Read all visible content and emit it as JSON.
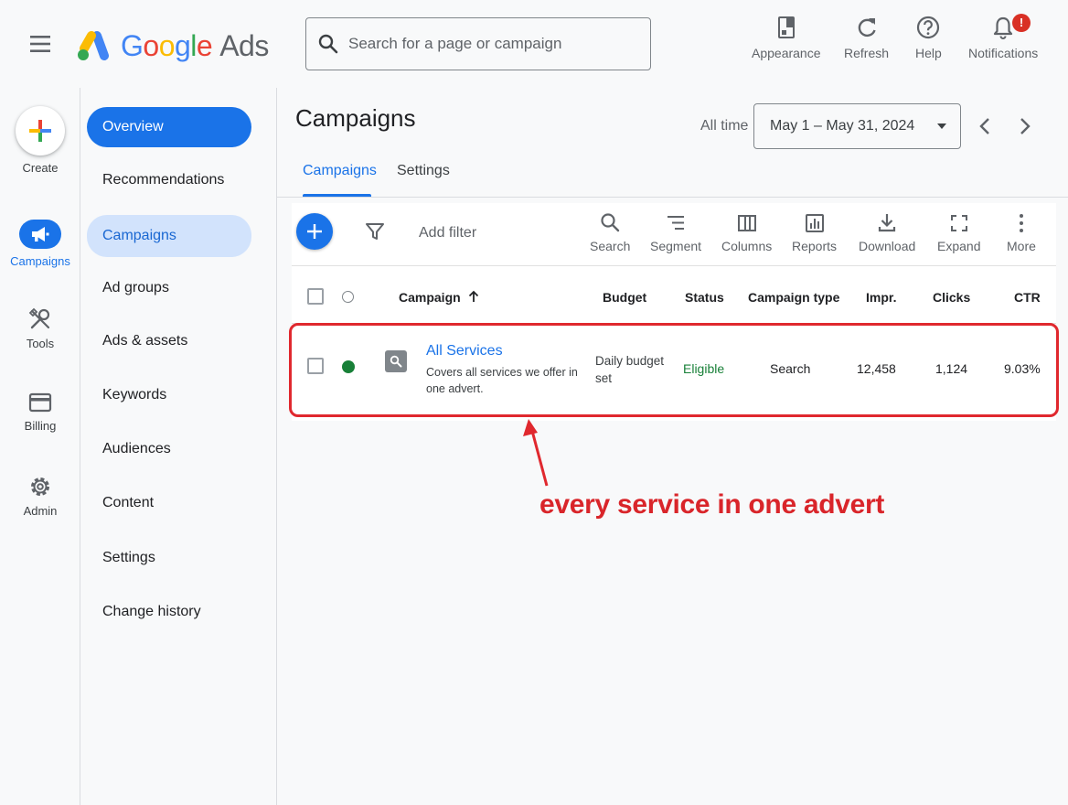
{
  "brand": {
    "google": "Google",
    "ads": "Ads"
  },
  "search": {
    "placeholder": "Search for a page or campaign"
  },
  "top_actions": {
    "appearance": "Appearance",
    "refresh": "Refresh",
    "help": "Help",
    "notifications": "Notifications",
    "notifications_badge": "!"
  },
  "rail": {
    "create": "Create",
    "campaigns": "Campaigns",
    "tools": "Tools",
    "billing": "Billing",
    "admin": "Admin"
  },
  "nav": {
    "items": [
      "Overview",
      "Recommendations",
      "Campaigns",
      "Ad groups",
      "Ads & assets",
      "Keywords",
      "Audiences",
      "Content",
      "Settings",
      "Change history"
    ],
    "selected": "Campaigns"
  },
  "page": {
    "title": "Campaigns",
    "date_label": "All time",
    "date_range": "May 1 – May 31, 2024",
    "tabs": [
      "Campaigns",
      "Settings"
    ],
    "active_tab": "Campaigns"
  },
  "toolbar": {
    "add_filter": "Add filter",
    "tools": [
      "Search",
      "Segment",
      "Columns",
      "Reports",
      "Download",
      "Expand",
      "More"
    ]
  },
  "table": {
    "headers": {
      "campaign": "Campaign",
      "budget": "Budget",
      "status": "Status",
      "campaign_type": "Campaign type",
      "impr": "Impr.",
      "clicks": "Clicks",
      "ctr": "CTR"
    },
    "rows": [
      {
        "name": "All Services",
        "description": "Covers all services we offer in one advert.",
        "budget": "Daily budget set",
        "status": "Eligible",
        "campaign_type": "Search",
        "impr": "12,458",
        "clicks": "1,124",
        "ctr": "9.03%"
      }
    ]
  },
  "annotation": {
    "text": "every service in one advert",
    "color": "#d9252a"
  },
  "colors": {
    "accent": "#1a73e8",
    "status_green": "#188038",
    "alert_red": "#d93025"
  }
}
